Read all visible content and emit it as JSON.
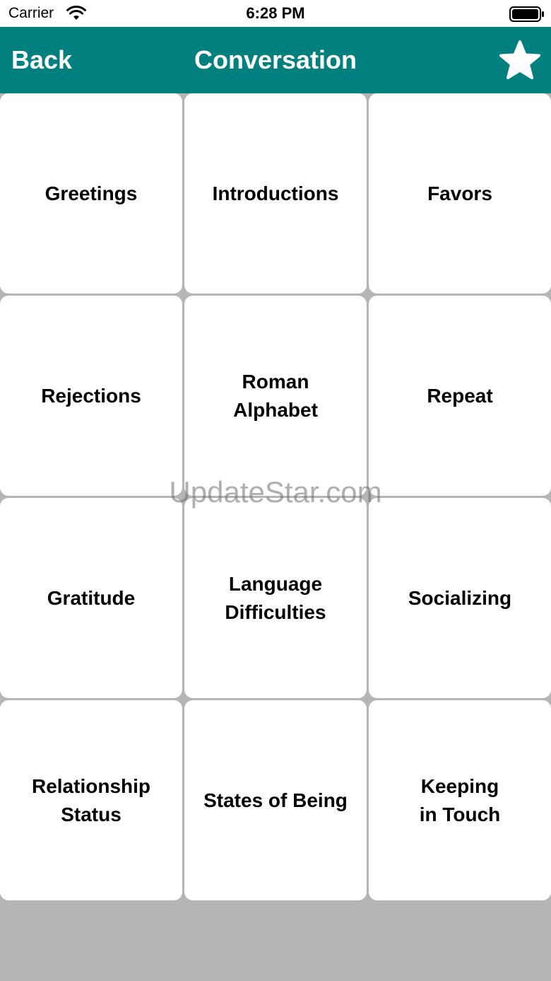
{
  "status_bar": {
    "carrier": "Carrier",
    "time": "6:28 PM"
  },
  "nav": {
    "back_label": "Back",
    "title": "Conversation",
    "favorite_icon": "star-icon"
  },
  "colors": {
    "nav_background": "#028080",
    "nav_text": "#ffffff",
    "page_background": "#b5b5b5",
    "tile_background": "#ffffff"
  },
  "categories": [
    {
      "label": "Greetings"
    },
    {
      "label": "Introductions"
    },
    {
      "label": "Favors"
    },
    {
      "label": "Rejections"
    },
    {
      "label": "Roman\nAlphabet"
    },
    {
      "label": "Repeat"
    },
    {
      "label": "Gratitude"
    },
    {
      "label": "Language\nDifficulties"
    },
    {
      "label": "Socializing"
    },
    {
      "label": "Relationship\nStatus"
    },
    {
      "label": "States of Being"
    },
    {
      "label": "Keeping\nin Touch"
    }
  ],
  "watermark": "UpdateStar.com"
}
